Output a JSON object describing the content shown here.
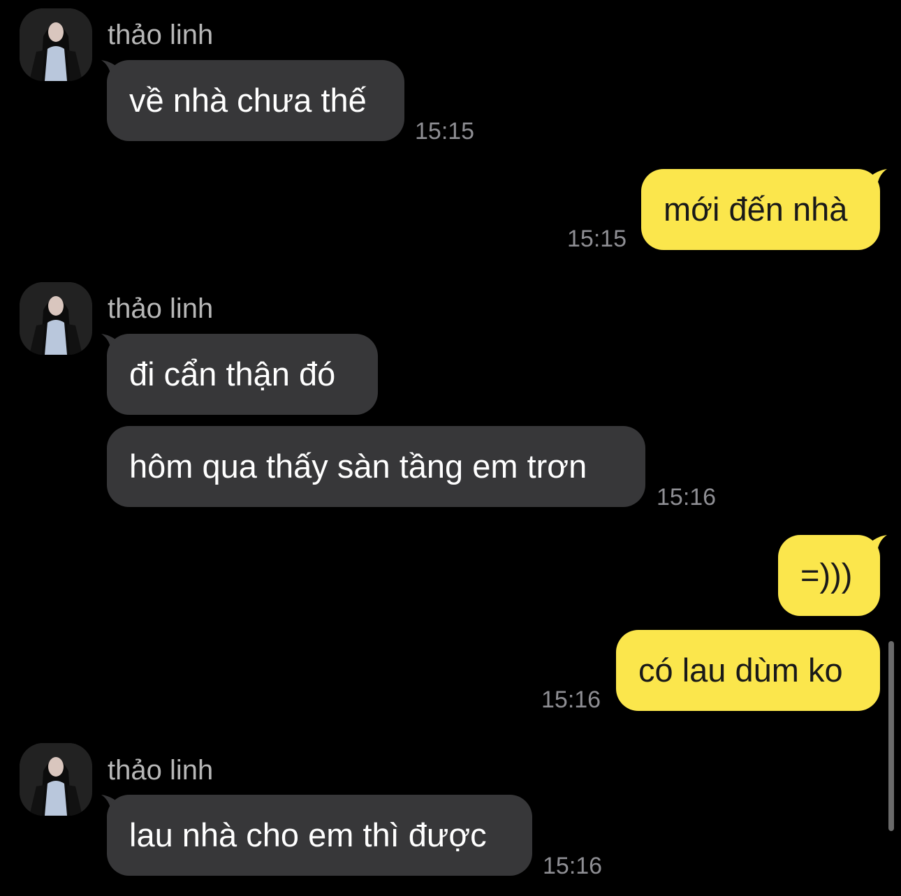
{
  "contact": {
    "name": "thảo linh"
  },
  "messages": [
    {
      "sender": "contact",
      "text": "về nhà chưa thế",
      "time": "15:15"
    },
    {
      "sender": "me",
      "text": "mới đến nhà",
      "time": "15:15"
    },
    {
      "sender": "contact",
      "text": "đi cẩn thận đó",
      "time": ""
    },
    {
      "sender": "contact",
      "text": "hôm qua thấy sàn tầng em trơn",
      "time": "15:16"
    },
    {
      "sender": "me",
      "text": "=)))",
      "time": ""
    },
    {
      "sender": "me",
      "text": "có lau dùm ko",
      "time": "15:16"
    },
    {
      "sender": "contact",
      "text": "lau nhà cho em thì được",
      "time": "15:16"
    }
  ],
  "colors": {
    "background": "#000000",
    "received_bubble": "#373739",
    "sent_bubble": "#fbe64c",
    "timestamp": "#8e8e93",
    "name": "#b7b7b7"
  }
}
